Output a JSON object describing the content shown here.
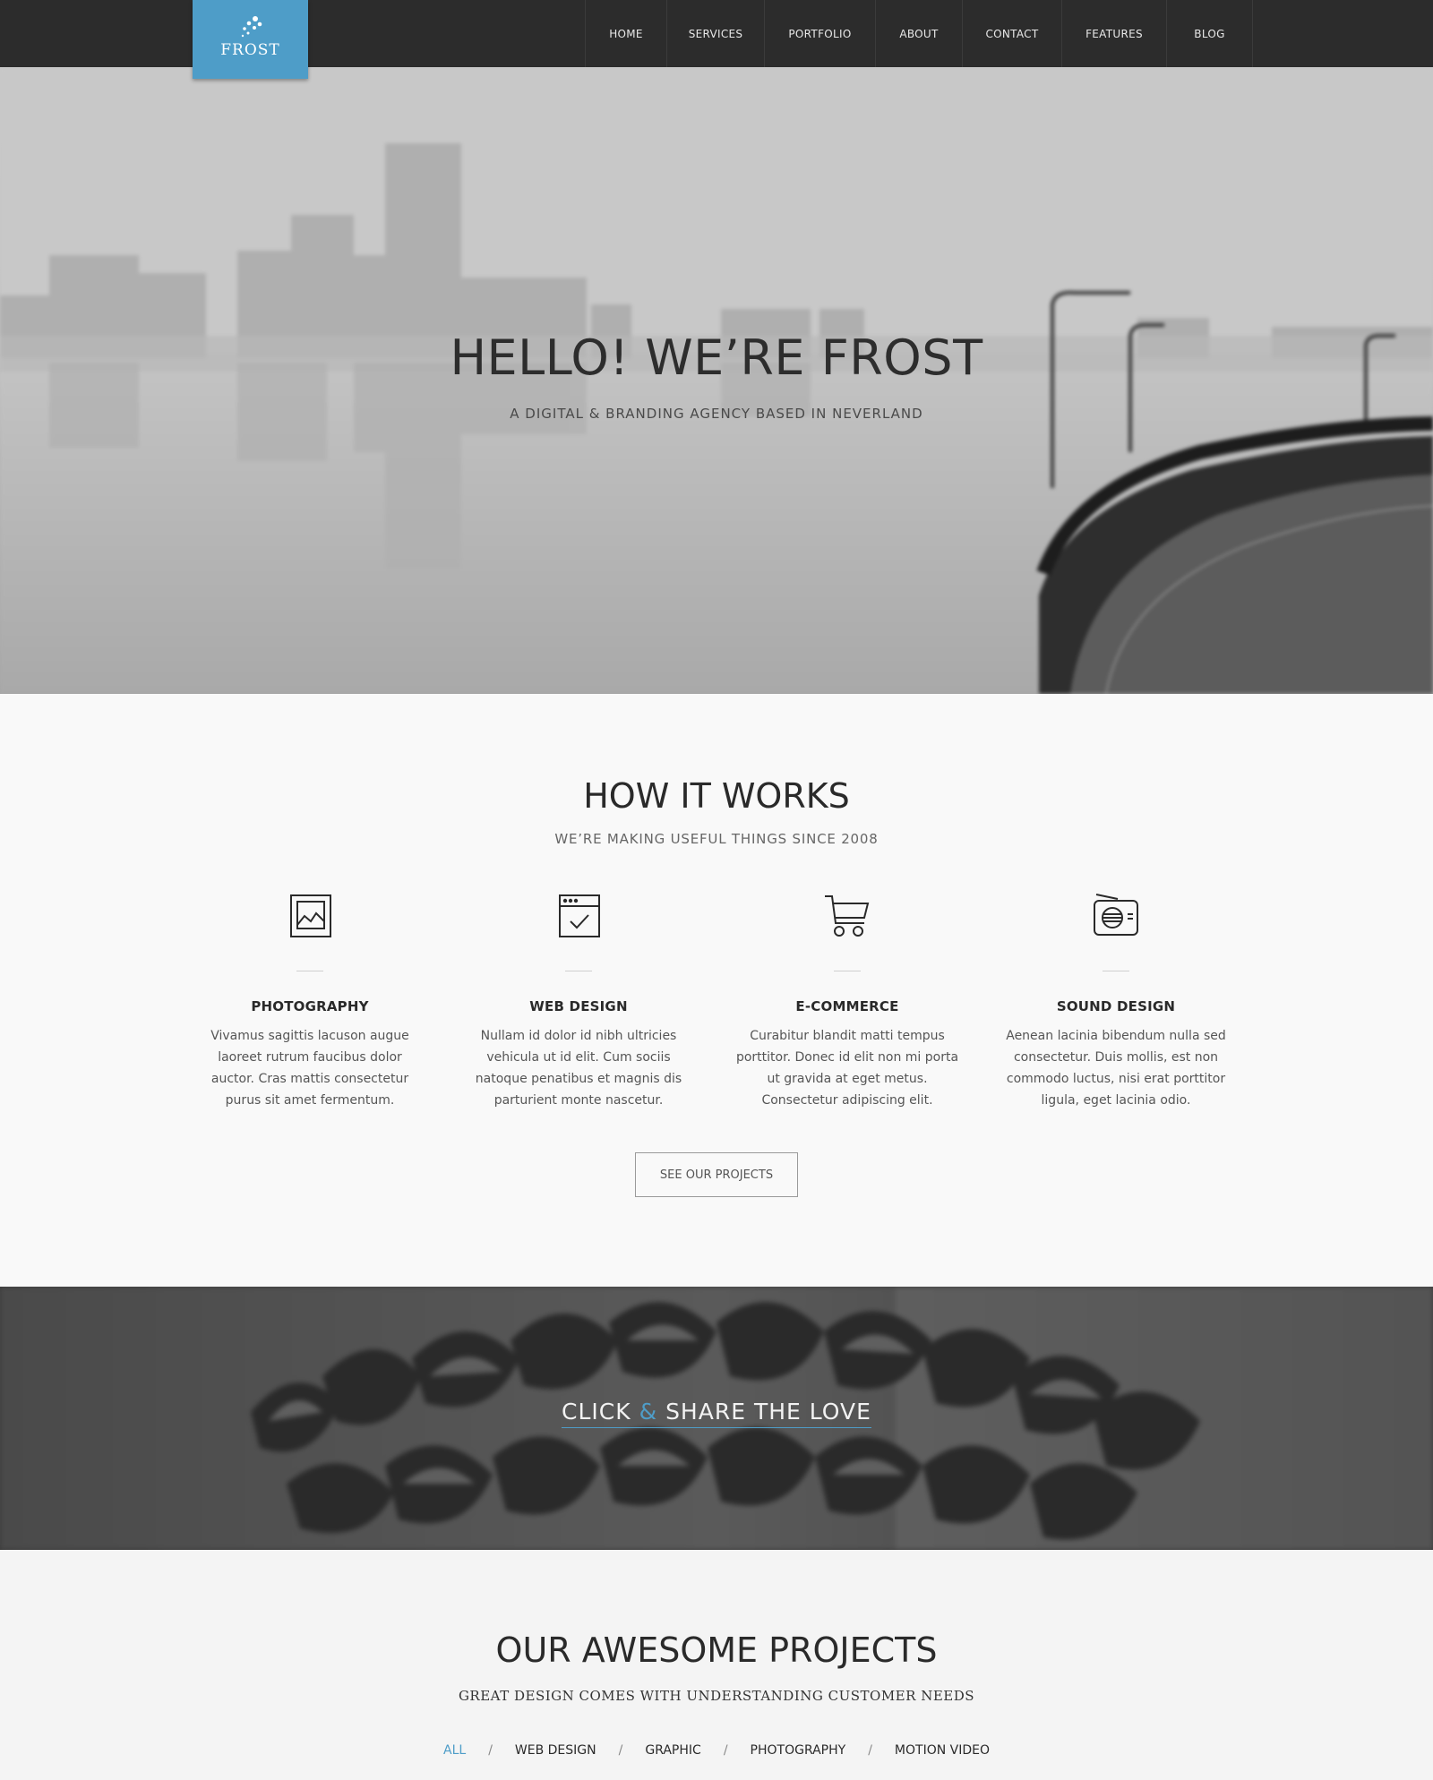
{
  "brand": {
    "name": "FROST",
    "accent_color": "#4e9dc8",
    "nav_bg": "#2c2c2c"
  },
  "nav": {
    "items": [
      {
        "label": "HOME"
      },
      {
        "label": "SERVICES"
      },
      {
        "label": "PORTFOLIO"
      },
      {
        "label": "ABOUT"
      },
      {
        "label": "CONTACT"
      },
      {
        "label": "FEATURES"
      },
      {
        "label": "BLOG"
      }
    ]
  },
  "hero": {
    "title": "HELLO! WE’RE FROST",
    "subtitle": "A DIGITAL & BRANDING AGENCY BASED IN NEVERLAND"
  },
  "how": {
    "title": "HOW IT WORKS",
    "subtitle": "WE’RE MAKING USEFUL THINGS SINCE 2008",
    "features": [
      {
        "icon": "photo-frame-icon",
        "title": "PHOTOGRAPHY",
        "text": "Vivamus sagittis lacuson augue laoreet rutrum faucibus dolor auctor. Cras mattis consectetur purus sit amet fermentum."
      },
      {
        "icon": "browser-check-icon",
        "title": "WEB DESIGN",
        "text": "Nullam id dolor id nibh ultricies vehicula ut id elit. Cum sociis natoque penatibus et magnis dis parturient monte nascetur."
      },
      {
        "icon": "shopping-cart-icon",
        "title": "E-COMMERCE",
        "text": "Curabitur blandit matti tempus porttitor. Donec id elit non mi porta ut gravida at eget metus. Consectetur adipiscing elit."
      },
      {
        "icon": "radio-icon",
        "title": "SOUND DESIGN",
        "text": "Aenean lacinia bibendum nulla sed consectetur. Duis mollis, est non commodo luctus, nisi erat porttitor ligula, eget lacinia odio."
      }
    ],
    "cta_label": "SEE OUR PROJECTS"
  },
  "banner": {
    "text_before": "CLICK",
    "amp": "&",
    "text_after": "SHARE THE LOVE"
  },
  "projects": {
    "title": "OUR AWESOME PROJECTS",
    "subtitle": "GREAT DESIGN COMES WITH UNDERSTANDING CUSTOMER NEEDS",
    "filters": [
      {
        "label": "ALL",
        "active": true
      },
      {
        "label": "WEB DESIGN",
        "active": false
      },
      {
        "label": "GRAPHIC",
        "active": false
      },
      {
        "label": "PHOTOGRAPHY",
        "active": false
      },
      {
        "label": "MOTION VIDEO",
        "active": false
      }
    ],
    "separator": "/"
  }
}
